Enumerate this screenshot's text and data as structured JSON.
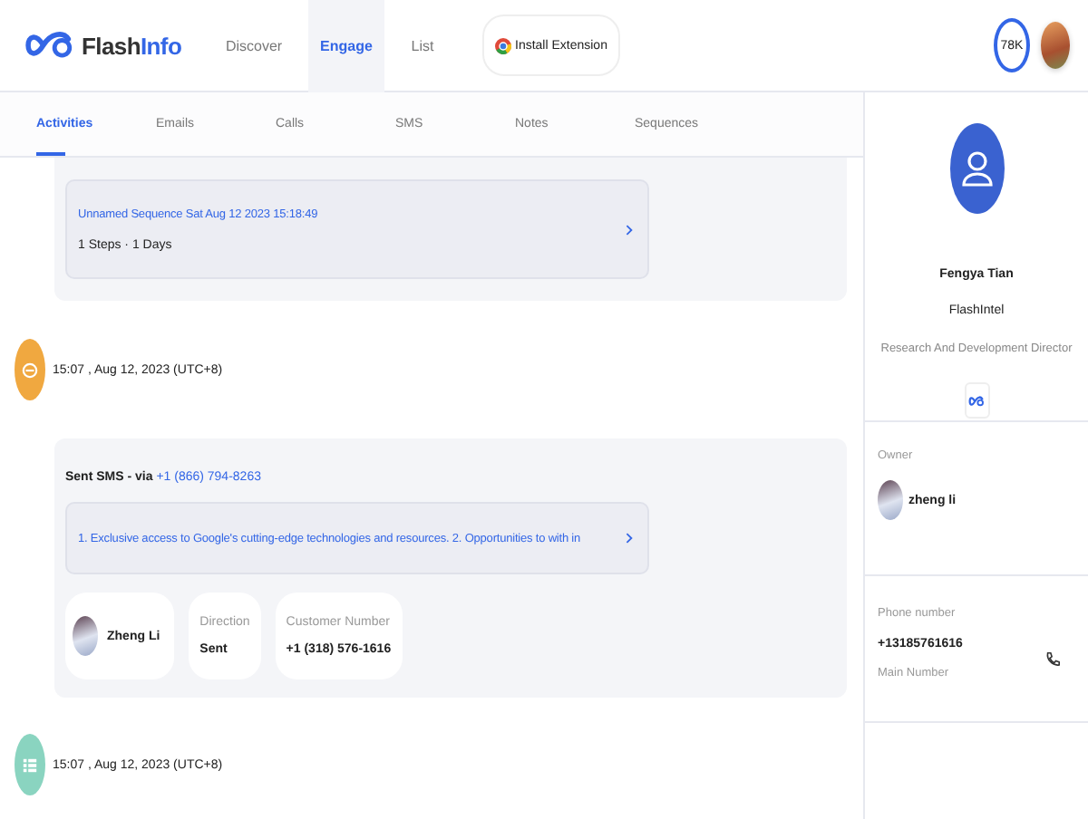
{
  "header": {
    "logo": [
      "Flash",
      "Info"
    ],
    "nav": [
      {
        "label": "Discover",
        "selected": false
      },
      {
        "label": "Engage",
        "selected": true
      },
      {
        "label": "List",
        "selected": false
      }
    ],
    "extension_button": "Install Extension",
    "credits": "78K"
  },
  "subtabs": [
    {
      "label": "Activities",
      "selected": true
    },
    {
      "label": "Emails",
      "selected": false
    },
    {
      "label": "Calls",
      "selected": false
    },
    {
      "label": "SMS",
      "selected": false
    },
    {
      "label": "Notes",
      "selected": false
    },
    {
      "label": "Sequences",
      "selected": false
    }
  ],
  "sequence_card": {
    "title": "Unnamed Sequence Sat Aug 12 2023 15:18:49",
    "meta": "1 Steps · 1 Days"
  },
  "activities": [
    {
      "kind": "sms",
      "time": "15:07 , Aug 12, 2023 (UTC+8)",
      "heading": "Sent SMS - via ",
      "number": "+1 (866) 794-8263",
      "message": "1. Exclusive access to Google's cutting-edge technologies and resources. 2. Opportunities to with in",
      "person": "Zheng Li",
      "fields": [
        {
          "label": "Direction",
          "value": "Sent"
        },
        {
          "label": "Customer Number",
          "value": "+1 (318) 576-1616"
        }
      ]
    },
    {
      "kind": "note",
      "time": "15:07 , Aug 12, 2023 (UTC+8)"
    }
  ],
  "contact": {
    "name": "Fengya Tian",
    "company": "FlashIntel",
    "title": "Research And Development Director"
  },
  "owner": {
    "label": "Owner",
    "name": "zheng li"
  },
  "phone": {
    "label": "Phone number",
    "number": "+13185761616",
    "type": "Main Number"
  }
}
